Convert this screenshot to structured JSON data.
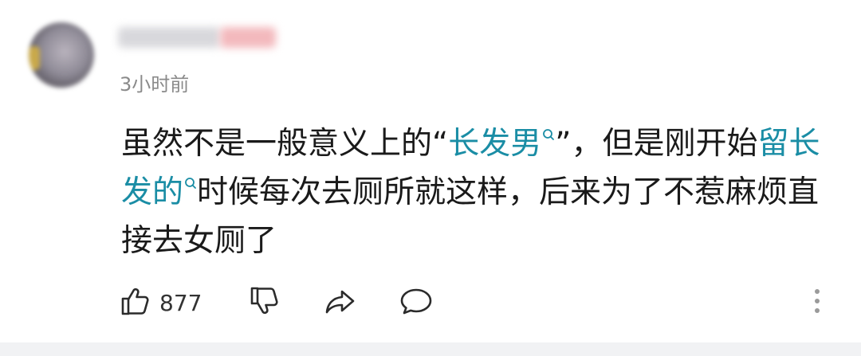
{
  "comment": {
    "timestamp": "3小时前",
    "text": {
      "line1_before": "虽然不是一般意义上的“",
      "line1_link": "长发男",
      "line1_after": "”，但是刚开始",
      "line1_link2": "留长",
      "line2_link": "发的",
      "line2_after": "时候每次去厕所就这样，后来为了不惹麻烦直",
      "line3": "接去女厕了"
    },
    "link_color": "#1a8da5"
  },
  "actions": {
    "like_count": "877",
    "icons": [
      "thumbs-up-icon",
      "thumbs-down-icon",
      "share-icon",
      "comment-icon",
      "more-vertical-icon"
    ]
  }
}
